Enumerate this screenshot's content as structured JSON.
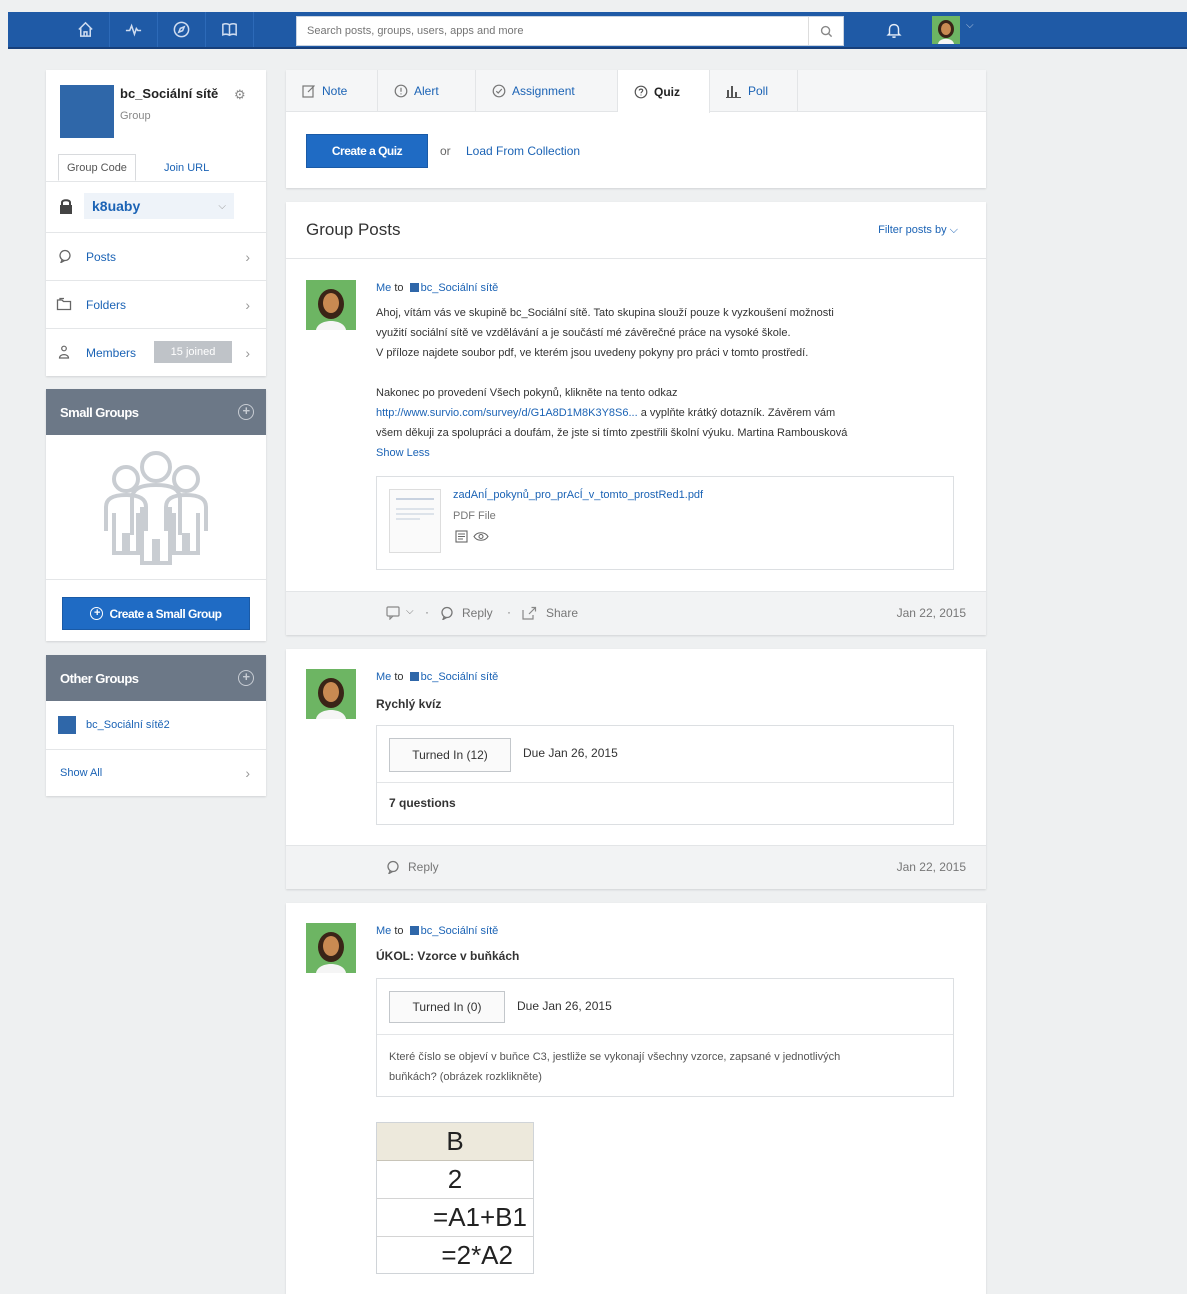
{
  "topnav": {
    "search_placeholder": "Search posts, groups, users, apps and more"
  },
  "group": {
    "name": "bc_Sociální sítě",
    "type": "Group",
    "code_tab": "Group Code",
    "join_tab": "Join URL",
    "code": "k8uaby"
  },
  "sidebar": {
    "posts": "Posts",
    "folders": "Folders",
    "members": "Members",
    "members_badge": "15 joined"
  },
  "small_groups": {
    "title": "Small Groups",
    "create_button": "Create a Small Group"
  },
  "other_groups": {
    "title": "Other Groups",
    "item": "bc_Sociální sítě2",
    "show_all": "Show All"
  },
  "post_tabs": [
    "Note",
    "Alert",
    "Assignment",
    "Quiz",
    "Poll"
  ],
  "composer": {
    "create_button": "Create a Quiz",
    "or": "or",
    "load_link": "Load From Collection"
  },
  "feed": {
    "title": "Group Posts",
    "filter": "Filter posts by"
  },
  "post1": {
    "from": "Me",
    "to_word": "to",
    "group": "bc_Sociální sítě",
    "line1": "Ahoj, vítám vás ve skupině bc_Sociální sítě. Tato skupina slouží pouze k vyzkoušení možnosti",
    "line2": "využití sociální sítě ve vzdělávání a je součástí mé závěrečné práce na vysoké škole.",
    "line3": "V příloze najdete soubor pdf, ve kterém jsou uvedeny pokyny pro práci v tomto prostředí.",
    "line4": "Nakonec po provedení Všech pokynů, klikněte na tento odkaz",
    "link": "http://www.survio.com/survey/d/G1A8D1M8K3Y8S6...",
    "line5": " a vyplňte krátký dotazník. Závěrem vám",
    "line6": "všem děkuji za spolupráci a doufám, že jste si tímto zpestřili školní výuku. Martina Rambousková",
    "show_less": "Show Less",
    "file_name": "zadAnÍ_pokynů_pro_prAcÍ_v_tomto_prostRed1.pdf",
    "file_type": "PDF File",
    "reply": "Reply",
    "share": "Share",
    "date": "Jan 22, 2015"
  },
  "post2": {
    "from": "Me",
    "to_word": "to",
    "group": "bc_Sociální sítě",
    "title": "Rychlý kvíz",
    "turned_in": "Turned In (12)",
    "due": "Due Jan 26, 2015",
    "questions": "7 questions",
    "reply": "Reply",
    "date": "Jan 22, 2015"
  },
  "post3": {
    "from": "Me",
    "to_word": "to",
    "group": "bc_Sociální sítě",
    "title": "ÚKOL: Vzorce v buňkách",
    "turned_in": "Turned In (0)",
    "due": "Due Jan 26, 2015",
    "desc1": "Které číslo se objeví v buňce C3, jestliže se vykonají všechny vzorce, zapsané v jednotlivých",
    "desc2": "buňkách? (obrázek rozklikněte)",
    "table": {
      "header": "B",
      "rows": [
        "2",
        "=A1+B1",
        "=2*A2"
      ]
    }
  },
  "colors": {
    "topbar": "#1f5aa6",
    "accent": "#1f6bc4",
    "panel_header": "#6c7887",
    "avatar_bg": "#6db563"
  }
}
